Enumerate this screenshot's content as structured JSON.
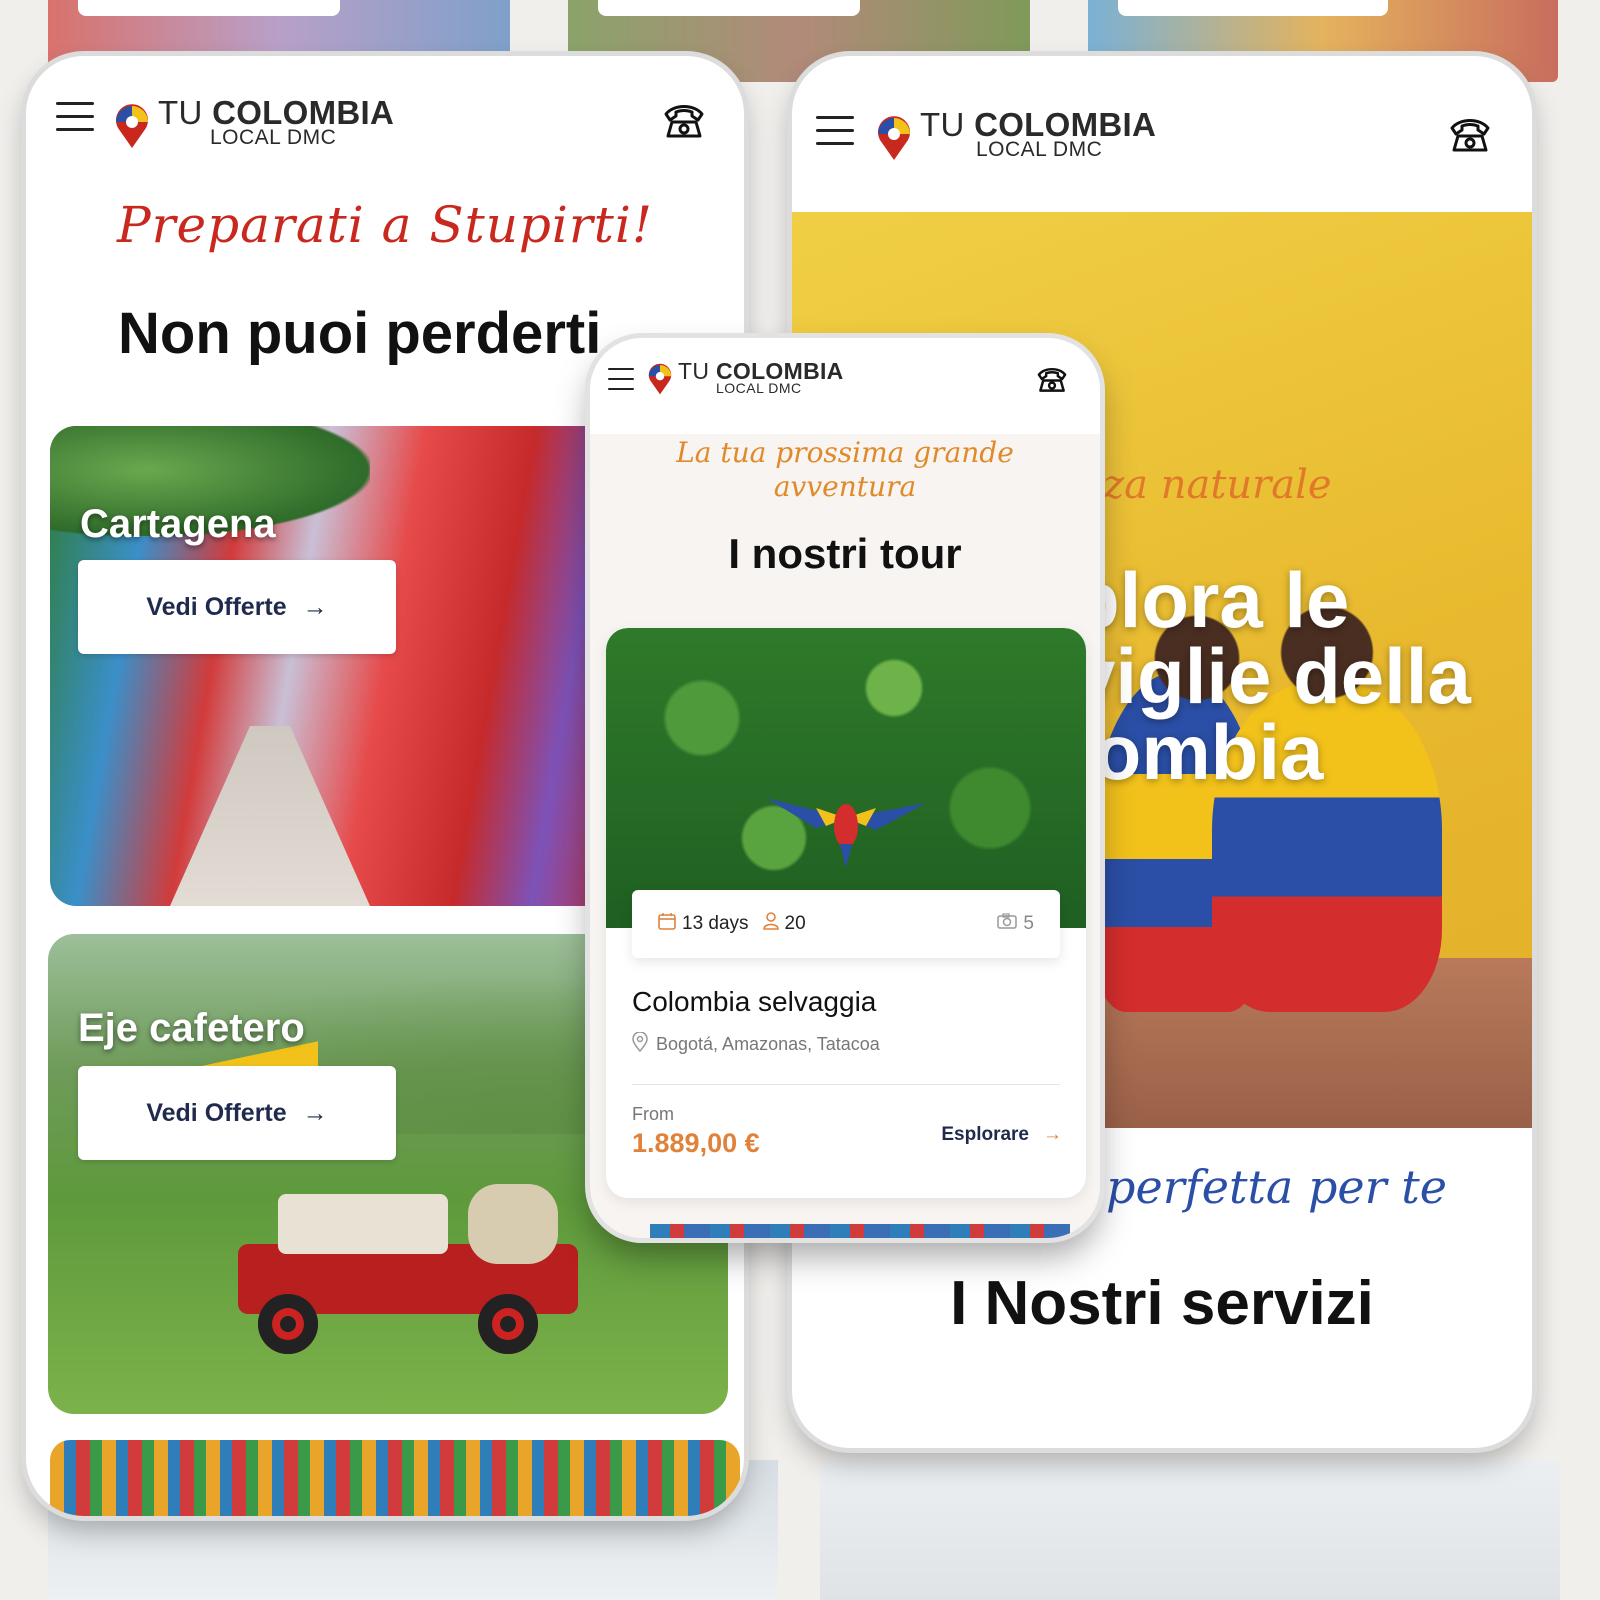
{
  "left_phone": {
    "logo": {
      "tu": "TU",
      "colombia": "COLOMBIA",
      "sub": "LOCAL DMC"
    },
    "tagline": "Preparati a Stupirti!",
    "heading": "Non puoi perderti",
    "destinations": [
      {
        "name": "Cartagena",
        "button": "Vedi Offerte"
      },
      {
        "name": "Eje cafetero",
        "button": "Vedi Offerte"
      }
    ]
  },
  "right_phone": {
    "logo": {
      "tu": "TU",
      "colombia": "COLOMBIA",
      "sub": "LOCAL DMC"
    },
    "hero_script": "zza naturale",
    "hero_title_lines": [
      "plora le",
      "viglie della",
      "lombia"
    ],
    "section_script": "a perfetta per te",
    "section_heading": "I Nostri servizi"
  },
  "center_phone": {
    "logo": {
      "tu": "TU",
      "colombia": "COLOMBIA",
      "sub": "LOCAL DMC"
    },
    "tagline": "La tua prossima grande avventura",
    "heading": "I nostri tour",
    "tour": {
      "days": "13 days",
      "people": "20",
      "photos": "5",
      "title": "Colombia selvaggia",
      "locations": "Bogotá, Amazonas, Tatacoa",
      "from_label": "From",
      "price": "1.889,00 €",
      "cta": "Esplorare"
    }
  },
  "icons": [
    "hamburger-icon",
    "phone-icon",
    "arrow-right-icon",
    "calendar-icon",
    "user-icon",
    "camera-icon",
    "location-pin-icon"
  ],
  "colors": {
    "brand_red": "#c8281e",
    "script_orange": "#e08a2a",
    "script_blue": "#2b4fa6",
    "price_orange": "#e0823a",
    "navy": "#1f2a4d"
  }
}
